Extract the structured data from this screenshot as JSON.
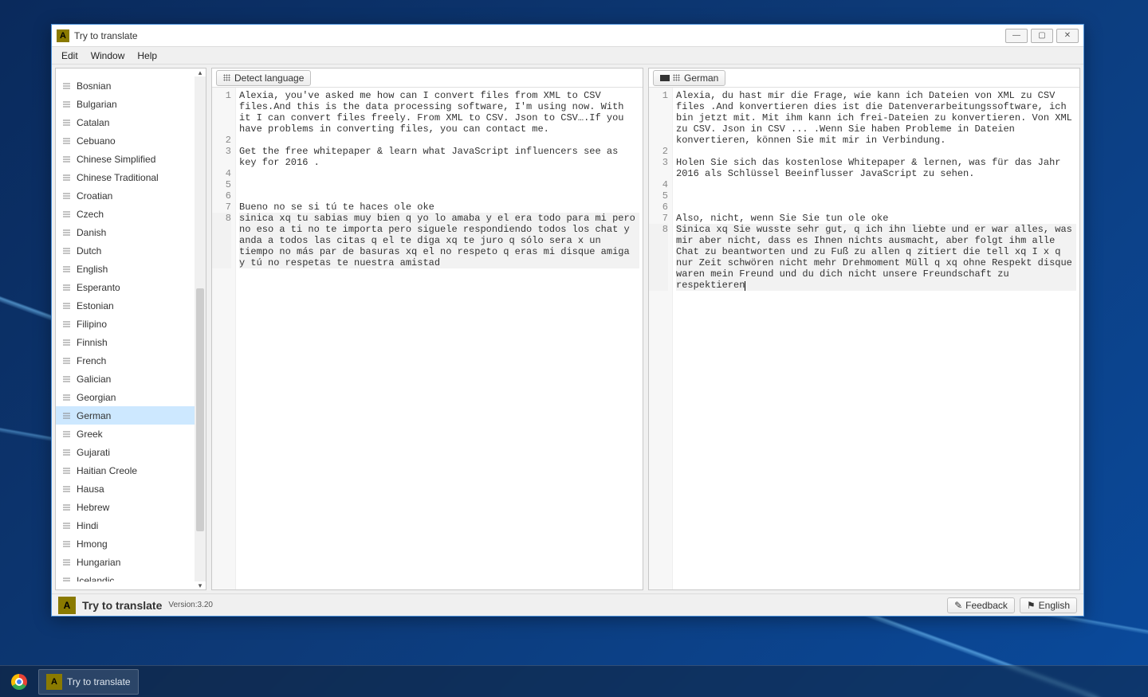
{
  "window": {
    "title": "Try to translate"
  },
  "menu": {
    "edit": "Edit",
    "window": "Window",
    "help": "Help"
  },
  "languages": [
    "Bosnian",
    "Bulgarian",
    "Catalan",
    "Cebuano",
    "Chinese Simplified",
    "Chinese Traditional",
    "Croatian",
    "Czech",
    "Danish",
    "Dutch",
    "English",
    "Esperanto",
    "Estonian",
    "Filipino",
    "Finnish",
    "French",
    "Galician",
    "Georgian",
    "German",
    "Greek",
    "Gujarati",
    "Haitian Creole",
    "Hausa",
    "Hebrew",
    "Hindi",
    "Hmong",
    "Hungarian",
    "Icelandic"
  ],
  "selected_language_index": 18,
  "left_pane": {
    "button_label": "Detect language",
    "lines": [
      {
        "n": "1",
        "t": "Alexia, you've asked me how can I convert files from XML to CSV files.And this is the data processing software, I'm using now. With it I can convert files freely. From XML to CSV. Json to CSV….If you have problems in converting files, you can contact me."
      },
      {
        "n": "2",
        "t": ""
      },
      {
        "n": "3",
        "t": "Get the free whitepaper & learn what JavaScript influencers see as key for 2016 ."
      },
      {
        "n": "4",
        "t": ""
      },
      {
        "n": "5",
        "t": ""
      },
      {
        "n": "6",
        "t": ""
      },
      {
        "n": "7",
        "t": "Bueno no se si tú te haces ole oke"
      },
      {
        "n": "8",
        "t": "sinica xq tu sabias muy bien q yo lo amaba y el era todo para mi pero no eso a ti no te importa pero siguele respondiendo todos los chat y anda a todos las citas q el te diga xq te juro q sólo sera x un tiempo no más par de basuras xq el no respeto q eras mi disque amiga y tú no respetas te nuestra amistad",
        "hl": true
      }
    ]
  },
  "right_pane": {
    "button_label": "German",
    "lines": [
      {
        "n": "1",
        "t": "Alexia, du hast mir die Frage, wie kann ich Dateien von XML zu CSV files .And konvertieren dies ist die Datenverarbeitungssoftware, ich bin jetzt mit. Mit ihm kann ich frei-Dateien zu konvertieren. Von XML zu CSV. Json in CSV ... .Wenn Sie haben Probleme in Dateien konvertieren, können Sie mit mir in Verbindung."
      },
      {
        "n": "2",
        "t": ""
      },
      {
        "n": "3",
        "t": "Holen Sie sich das kostenlose Whitepaper & lernen, was für das Jahr 2016 als Schlüssel Beeinflusser JavaScript zu sehen."
      },
      {
        "n": "4",
        "t": ""
      },
      {
        "n": "5",
        "t": ""
      },
      {
        "n": "6",
        "t": ""
      },
      {
        "n": "7",
        "t": "Also, nicht, wenn Sie Sie tun ole oke"
      },
      {
        "n": "8",
        "t": "Sinica xq Sie wusste sehr gut, q ich ihn liebte und er war alles, was mir aber nicht, dass es Ihnen nichts ausmacht, aber folgt ihm alle Chat zu beantworten und zu Fuß zu allen q zitiert die tell xq I x q nur Zeit schwören nicht mehr Drehmoment Müll q xq ohne Respekt disque waren mein Freund und du dich nicht unsere Freundschaft zu respektieren",
        "hl": true,
        "cursor": true
      }
    ]
  },
  "status": {
    "title": "Try to translate",
    "version": "Version:3.20",
    "feedback": "Feedback",
    "english": "English"
  },
  "taskbar": {
    "app_label": "Try to translate"
  }
}
